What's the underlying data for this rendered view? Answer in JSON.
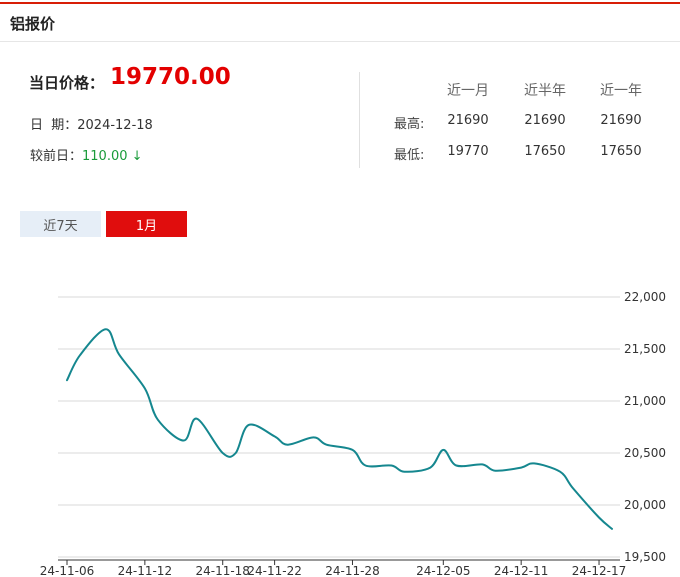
{
  "panel_title": "铝报价",
  "price": {
    "label": "当日价格：",
    "value": "19770.00"
  },
  "date": {
    "label": "日  期：",
    "value": "2024-12-18"
  },
  "change": {
    "label": "较前日：",
    "value": "110.00 ↓"
  },
  "stats": {
    "headers": [
      "近一月",
      "近半年",
      "近一年"
    ],
    "rows": [
      {
        "label": "最高:",
        "values": [
          "21690",
          "21690",
          "21690"
        ]
      },
      {
        "label": "最低:",
        "values": [
          "19770",
          "17650",
          "17650"
        ]
      }
    ]
  },
  "tabs": [
    {
      "label": "近7天",
      "active": false
    },
    {
      "label": "1月",
      "active": true
    }
  ],
  "colors": {
    "accent": "#e00d0d",
    "line": "#15878f",
    "down": "#1a9b3a"
  },
  "chart_data": {
    "type": "line",
    "x": [
      "2024-11-06",
      "2024-11-07",
      "2024-11-08",
      "2024-11-09",
      "2024-11-10",
      "2024-11-11",
      "2024-11-12",
      "2024-11-13",
      "2024-11-14",
      "2024-11-15",
      "2024-11-16",
      "2024-11-17",
      "2024-11-18",
      "2024-11-19",
      "2024-11-20",
      "2024-11-21",
      "2024-11-22",
      "2024-11-23",
      "2024-11-24",
      "2024-11-25",
      "2024-11-26",
      "2024-11-27",
      "2024-11-28",
      "2024-11-29",
      "2024-11-30",
      "2024-12-01",
      "2024-12-02",
      "2024-12-03",
      "2024-12-04",
      "2024-12-05",
      "2024-12-06",
      "2024-12-07",
      "2024-12-08",
      "2024-12-09",
      "2024-12-10",
      "2024-12-11",
      "2024-12-12",
      "2024-12-13",
      "2024-12-14",
      "2024-12-15",
      "2024-12-16",
      "2024-12-17",
      "2024-12-18"
    ],
    "series": [
      {
        "values": [
          21200,
          21440,
          21690,
          21450,
          21120,
          20820,
          20620,
          20830,
          20500,
          20500,
          20770,
          20660,
          20580,
          20650,
          20580,
          20530,
          20380,
          20380,
          20320,
          20360,
          20530,
          20380,
          20390,
          20330,
          20360,
          20400,
          20320,
          20160,
          19880,
          19770
        ]
      }
    ],
    "xticks": [
      "24-11-06",
      "24-11-12",
      "24-11-18",
      "24-11-22",
      "24-11-28",
      "24-12-05",
      "24-12-11",
      "24-12-17"
    ],
    "yticks": [
      "22,000",
      "21,500",
      "21,000",
      "20,500",
      "20,000",
      "19,500"
    ],
    "ylim": [
      19500,
      22000
    ],
    "grid": true,
    "title": "",
    "xlabel": "",
    "ylabel": ""
  }
}
